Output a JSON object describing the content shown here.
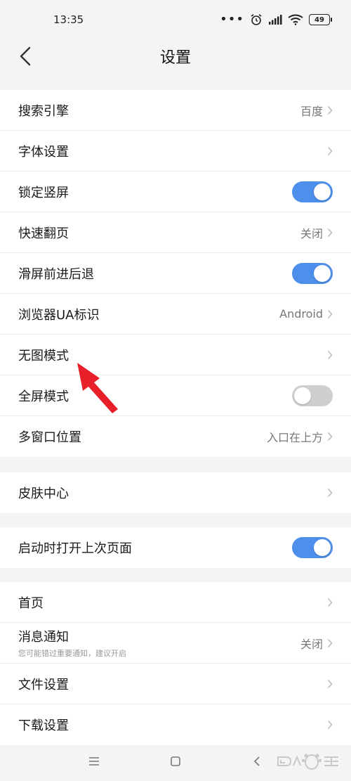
{
  "status_bar": {
    "time": "13:35",
    "battery": "49"
  },
  "header": {
    "title": "设置"
  },
  "groups": [
    {
      "items": [
        {
          "label": "搜索引擎",
          "value": "百度",
          "control": "chevron"
        },
        {
          "label": "字体设置",
          "value": "",
          "control": "chevron"
        },
        {
          "label": "锁定竖屏",
          "control": "toggle",
          "on": true
        },
        {
          "label": "快速翻页",
          "value": "关闭",
          "control": "chevron"
        },
        {
          "label": "滑屏前进后退",
          "control": "toggle",
          "on": true
        },
        {
          "label": "浏览器UA标识",
          "value": "Android",
          "control": "chevron"
        },
        {
          "label": "无图模式",
          "value": "",
          "control": "chevron"
        },
        {
          "label": "全屏模式",
          "control": "toggle",
          "on": false
        },
        {
          "label": "多窗口位置",
          "value": "入口在上方",
          "control": "chevron"
        }
      ]
    },
    {
      "items": [
        {
          "label": "皮肤中心",
          "value": "",
          "control": "chevron"
        }
      ]
    },
    {
      "items": [
        {
          "label": "启动时打开上次页面",
          "control": "toggle",
          "on": true
        }
      ]
    },
    {
      "items": [
        {
          "label": "首页",
          "value": "",
          "control": "chevron"
        },
        {
          "label": "消息通知",
          "sublabel": "您可能错过重要通知，建议开启",
          "value": "关闭",
          "control": "chevron"
        },
        {
          "label": "文件设置",
          "value": "",
          "control": "chevron"
        },
        {
          "label": "下载设置",
          "value": "",
          "control": "chevron"
        }
      ]
    }
  ],
  "colors": {
    "accent": "#4d8fea",
    "toggle_off": "#cfcfcf",
    "annotation": "#e8202a"
  },
  "icons": {
    "back": "chevron-left-icon",
    "chevron": "chevron-right-icon",
    "nav_menu": "menu-icon",
    "nav_home": "square-icon",
    "nav_back": "chevron-left-icon"
  }
}
